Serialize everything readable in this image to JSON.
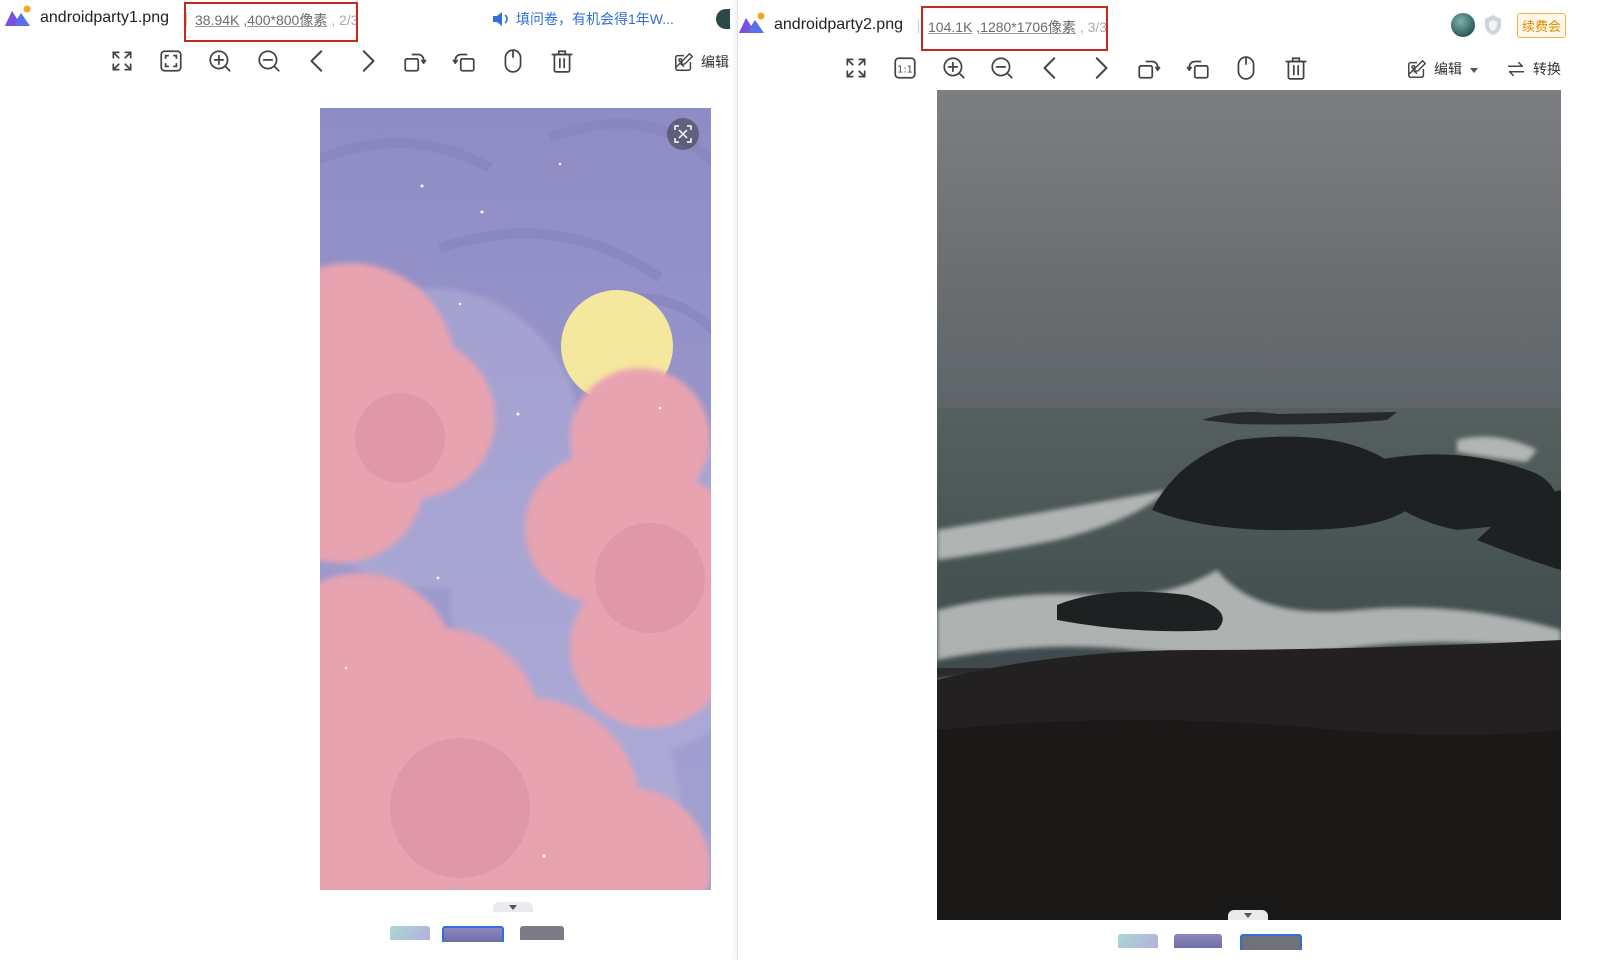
{
  "left_window": {
    "filename": "androidparty1.png",
    "file_size": "38.94K",
    "dimensions": "400*800像素",
    "page_indicator": "2/3",
    "notice": "填问卷，有机会得1年W...",
    "edit_label": "编辑",
    "toolbar_icons": [
      "fullscreen-icon",
      "fit-screen-icon",
      "zoom-in-icon",
      "zoom-out-icon",
      "previous-icon",
      "next-icon",
      "rotate-left-icon",
      "rotate-right-icon",
      "mouse-icon",
      "delete-icon"
    ]
  },
  "right_window": {
    "filename": "androidparty2.png",
    "file_size": "104.1K",
    "dimensions": "1280*1706像素",
    "page_indicator": "3/3",
    "edit_label": "编辑",
    "convert_label": "转换",
    "renew_label": "续费会",
    "toolbar_icons": [
      "fullscreen-icon",
      "actual-size-icon",
      "zoom-in-icon",
      "zoom-out-icon",
      "previous-icon",
      "next-icon",
      "rotate-left-icon",
      "rotate-right-icon",
      "mouse-icon",
      "delete-icon"
    ]
  },
  "colors": {
    "highlight_box": "#c8281e",
    "notice_blue": "#2f6fd6",
    "selected_thumb": "#2f6fd6"
  }
}
